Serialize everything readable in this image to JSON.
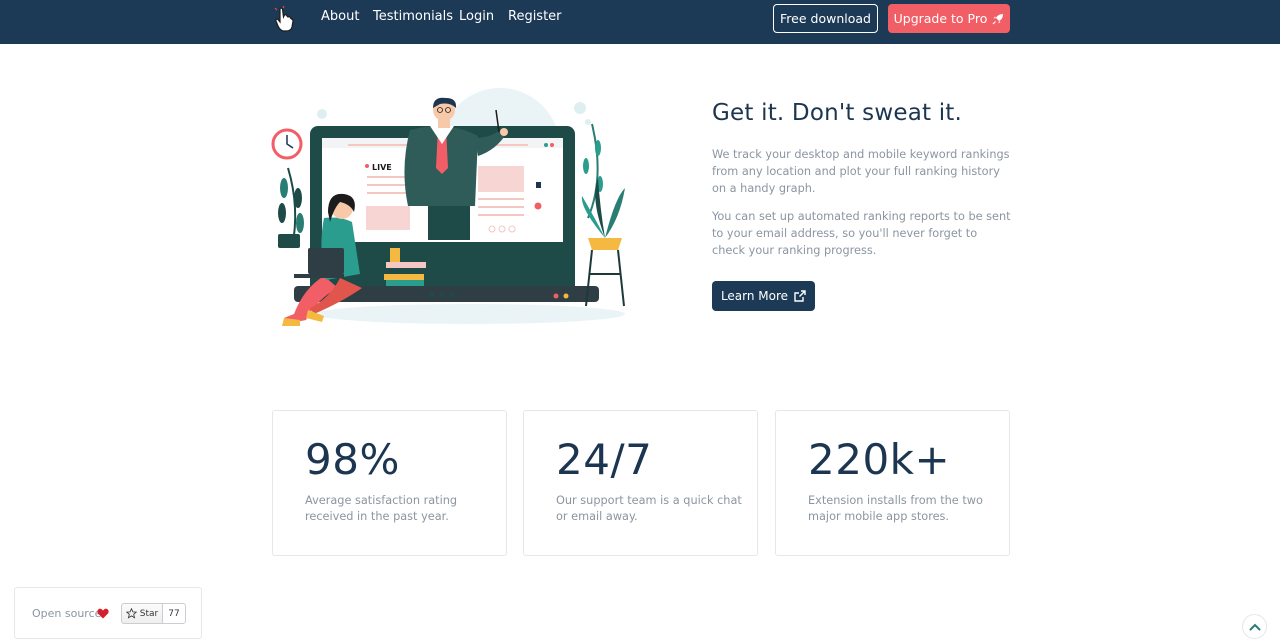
{
  "nav": {
    "links": [
      "About",
      "Testimonials",
      "Login",
      "Register"
    ],
    "free_download": "Free download",
    "upgrade": "Upgrade to Pro"
  },
  "hero": {
    "title": "Get it. Don't sweat it.",
    "paragraph1": "We track your desktop and mobile keyword rankings from any location and plot your full ranking history on a handy graph.",
    "paragraph2": "You can set up automated ranking reports to be sent to your email address, so you'll never forget to check your ranking progress.",
    "cta": "Learn More",
    "illustration_live_label": "LIVE"
  },
  "stats": [
    {
      "value": "98%",
      "description": "Average satisfaction rating received in the past year."
    },
    {
      "value": "24/7",
      "description": "Our support team is a quick chat or email away."
    },
    {
      "value": "220k+",
      "description": "Extension installs from the two major mobile app stores."
    }
  ],
  "open_source": {
    "label": "Open source",
    "star_label": "Star",
    "star_count": "77"
  },
  "colors": {
    "navbar": "#1c3a56",
    "accent": "#f25e66",
    "text_dark": "#1c3550",
    "text_muted": "#8b95a1"
  },
  "icons": [
    "hand-pointer-icon",
    "rocket-icon",
    "external-link-icon",
    "heart-icon",
    "star-icon",
    "chevron-up-icon"
  ]
}
